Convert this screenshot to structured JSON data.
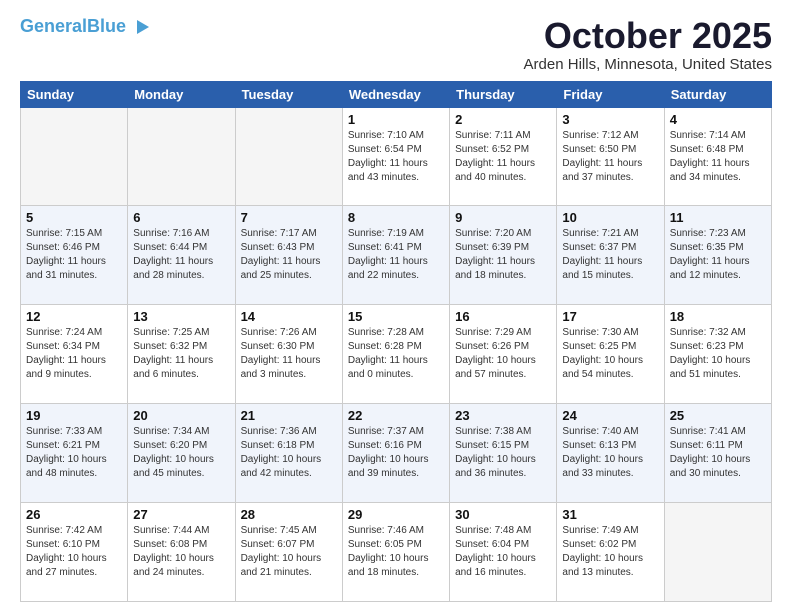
{
  "logo": {
    "line1": "General",
    "line2": "Blue",
    "triangle": "▶"
  },
  "title": "October 2025",
  "location": "Arden Hills, Minnesota, United States",
  "days_header": [
    "Sunday",
    "Monday",
    "Tuesday",
    "Wednesday",
    "Thursday",
    "Friday",
    "Saturday"
  ],
  "weeks": [
    [
      {
        "day": "",
        "info": ""
      },
      {
        "day": "",
        "info": ""
      },
      {
        "day": "",
        "info": ""
      },
      {
        "day": "1",
        "info": "Sunrise: 7:10 AM\nSunset: 6:54 PM\nDaylight: 11 hours\nand 43 minutes."
      },
      {
        "day": "2",
        "info": "Sunrise: 7:11 AM\nSunset: 6:52 PM\nDaylight: 11 hours\nand 40 minutes."
      },
      {
        "day": "3",
        "info": "Sunrise: 7:12 AM\nSunset: 6:50 PM\nDaylight: 11 hours\nand 37 minutes."
      },
      {
        "day": "4",
        "info": "Sunrise: 7:14 AM\nSunset: 6:48 PM\nDaylight: 11 hours\nand 34 minutes."
      }
    ],
    [
      {
        "day": "5",
        "info": "Sunrise: 7:15 AM\nSunset: 6:46 PM\nDaylight: 11 hours\nand 31 minutes."
      },
      {
        "day": "6",
        "info": "Sunrise: 7:16 AM\nSunset: 6:44 PM\nDaylight: 11 hours\nand 28 minutes."
      },
      {
        "day": "7",
        "info": "Sunrise: 7:17 AM\nSunset: 6:43 PM\nDaylight: 11 hours\nand 25 minutes."
      },
      {
        "day": "8",
        "info": "Sunrise: 7:19 AM\nSunset: 6:41 PM\nDaylight: 11 hours\nand 22 minutes."
      },
      {
        "day": "9",
        "info": "Sunrise: 7:20 AM\nSunset: 6:39 PM\nDaylight: 11 hours\nand 18 minutes."
      },
      {
        "day": "10",
        "info": "Sunrise: 7:21 AM\nSunset: 6:37 PM\nDaylight: 11 hours\nand 15 minutes."
      },
      {
        "day": "11",
        "info": "Sunrise: 7:23 AM\nSunset: 6:35 PM\nDaylight: 11 hours\nand 12 minutes."
      }
    ],
    [
      {
        "day": "12",
        "info": "Sunrise: 7:24 AM\nSunset: 6:34 PM\nDaylight: 11 hours\nand 9 minutes."
      },
      {
        "day": "13",
        "info": "Sunrise: 7:25 AM\nSunset: 6:32 PM\nDaylight: 11 hours\nand 6 minutes."
      },
      {
        "day": "14",
        "info": "Sunrise: 7:26 AM\nSunset: 6:30 PM\nDaylight: 11 hours\nand 3 minutes."
      },
      {
        "day": "15",
        "info": "Sunrise: 7:28 AM\nSunset: 6:28 PM\nDaylight: 11 hours\nand 0 minutes."
      },
      {
        "day": "16",
        "info": "Sunrise: 7:29 AM\nSunset: 6:26 PM\nDaylight: 10 hours\nand 57 minutes."
      },
      {
        "day": "17",
        "info": "Sunrise: 7:30 AM\nSunset: 6:25 PM\nDaylight: 10 hours\nand 54 minutes."
      },
      {
        "day": "18",
        "info": "Sunrise: 7:32 AM\nSunset: 6:23 PM\nDaylight: 10 hours\nand 51 minutes."
      }
    ],
    [
      {
        "day": "19",
        "info": "Sunrise: 7:33 AM\nSunset: 6:21 PM\nDaylight: 10 hours\nand 48 minutes."
      },
      {
        "day": "20",
        "info": "Sunrise: 7:34 AM\nSunset: 6:20 PM\nDaylight: 10 hours\nand 45 minutes."
      },
      {
        "day": "21",
        "info": "Sunrise: 7:36 AM\nSunset: 6:18 PM\nDaylight: 10 hours\nand 42 minutes."
      },
      {
        "day": "22",
        "info": "Sunrise: 7:37 AM\nSunset: 6:16 PM\nDaylight: 10 hours\nand 39 minutes."
      },
      {
        "day": "23",
        "info": "Sunrise: 7:38 AM\nSunset: 6:15 PM\nDaylight: 10 hours\nand 36 minutes."
      },
      {
        "day": "24",
        "info": "Sunrise: 7:40 AM\nSunset: 6:13 PM\nDaylight: 10 hours\nand 33 minutes."
      },
      {
        "day": "25",
        "info": "Sunrise: 7:41 AM\nSunset: 6:11 PM\nDaylight: 10 hours\nand 30 minutes."
      }
    ],
    [
      {
        "day": "26",
        "info": "Sunrise: 7:42 AM\nSunset: 6:10 PM\nDaylight: 10 hours\nand 27 minutes."
      },
      {
        "day": "27",
        "info": "Sunrise: 7:44 AM\nSunset: 6:08 PM\nDaylight: 10 hours\nand 24 minutes."
      },
      {
        "day": "28",
        "info": "Sunrise: 7:45 AM\nSunset: 6:07 PM\nDaylight: 10 hours\nand 21 minutes."
      },
      {
        "day": "29",
        "info": "Sunrise: 7:46 AM\nSunset: 6:05 PM\nDaylight: 10 hours\nand 18 minutes."
      },
      {
        "day": "30",
        "info": "Sunrise: 7:48 AM\nSunset: 6:04 PM\nDaylight: 10 hours\nand 16 minutes."
      },
      {
        "day": "31",
        "info": "Sunrise: 7:49 AM\nSunset: 6:02 PM\nDaylight: 10 hours\nand 13 minutes."
      },
      {
        "day": "",
        "info": ""
      }
    ]
  ]
}
